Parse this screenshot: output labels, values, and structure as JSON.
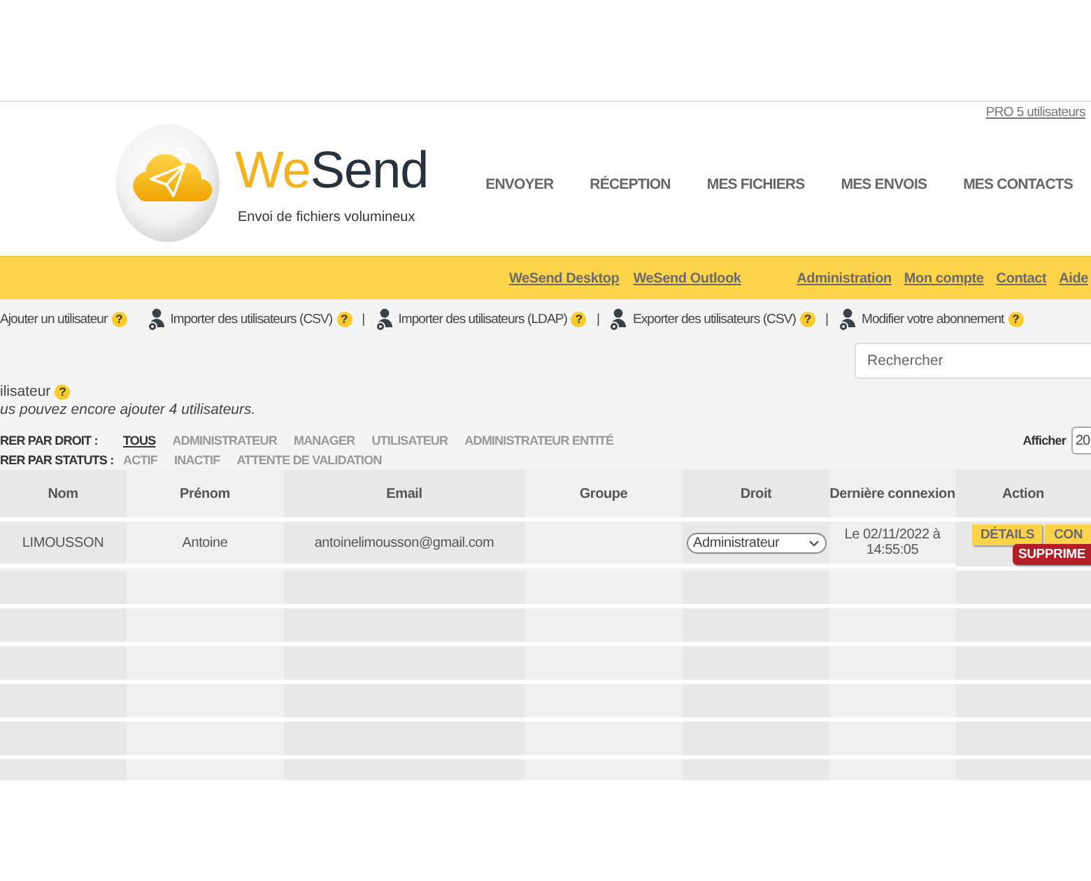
{
  "account_link": "PRO 5 utilisateurs",
  "logo": {
    "brand_part_1": "We",
    "brand_part_2": "Send",
    "tagline": "Envoi de fichiers volumineux"
  },
  "nav": [
    "ENVOYER",
    "RÉCEPTION",
    "MES FICHIERS",
    "MES ENVOIS",
    "MES CONTACTS"
  ],
  "top_links": {
    "left": [
      "WeSend Desktop",
      "WeSend Outlook"
    ],
    "right": [
      "Administration",
      "Mon compte",
      "Contact",
      "Aide"
    ]
  },
  "toolbar": [
    {
      "kind": "plain",
      "label": "Ajouter un utilisateur",
      "help": "?"
    },
    {
      "kind": "user",
      "label": "Importer des utilisateurs (CSV)",
      "help": "?"
    },
    {
      "kind": "user",
      "separator": "|",
      "label": "Importer des utilisateurs (LDAP)",
      "help": "?"
    },
    {
      "kind": "user",
      "separator": "|",
      "label": "Exporter des utilisateurs (CSV)",
      "help": "?"
    },
    {
      "kind": "user",
      "separator": "|",
      "label": "Modifier votre abonnement",
      "help": "?"
    }
  ],
  "search": {
    "placeholder": "Rechercher"
  },
  "section": {
    "title": "ilisateur",
    "help": "?",
    "note": "us pouvez encore ajouter 4 utilisateurs."
  },
  "filters": [
    {
      "label": "RER PAR DROIT :",
      "options": [
        {
          "label": "TOUS",
          "selected": true
        },
        {
          "label": "ADMINISTRATEUR",
          "selected": false
        },
        {
          "label": "MANAGER",
          "selected": false
        },
        {
          "label": "UTILISATEUR",
          "selected": false
        },
        {
          "label": "ADMINISTRATEUR ENTITÉ",
          "selected": false
        }
      ]
    },
    {
      "label": "RER PAR STATUTS :",
      "options": [
        {
          "label": "ACTIF",
          "selected": false
        },
        {
          "label": "INACTIF",
          "selected": false
        },
        {
          "label": "ATTENTE DE VALIDATION",
          "selected": false
        }
      ]
    }
  ],
  "page_size": {
    "label": "Afficher",
    "value": "20"
  },
  "table": {
    "columns": [
      "Nom",
      "Prénom",
      "Email",
      "Groupe",
      "Droit",
      "Dernière connexion",
      "Action"
    ],
    "rows": [
      {
        "nom": "LIMOUSSON",
        "prenom": "Antoine",
        "email": "antoinelimousson@gmail.com",
        "droit": "Administrateur",
        "last_login": "Le 02/11/2022 à 14:55:05",
        "actions": [
          {
            "kind": "primary",
            "label": "DÉTAILS"
          },
          {
            "kind": "primary",
            "label": "CON"
          },
          {
            "kind": "danger",
            "label": "SUPPRIME"
          }
        ]
      }
    ]
  }
}
